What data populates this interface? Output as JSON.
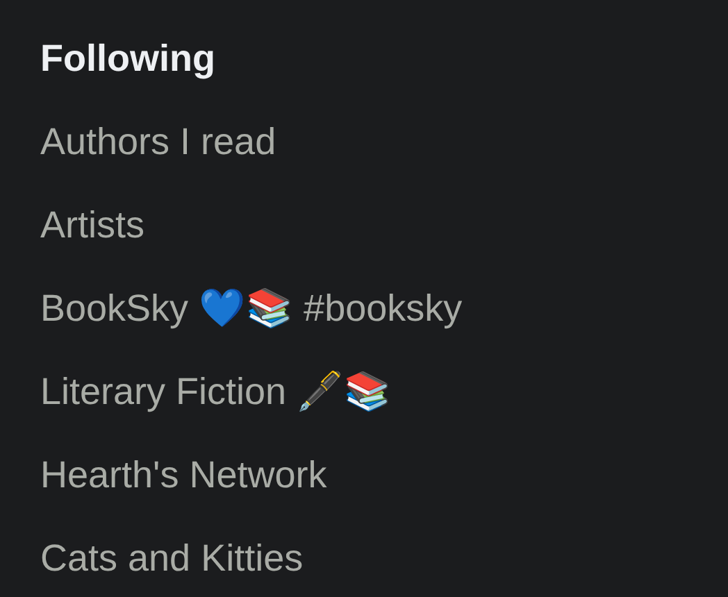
{
  "feeds": [
    {
      "label": "Following",
      "selected": true
    },
    {
      "label": "Authors I read",
      "selected": false
    },
    {
      "label": "Artists",
      "selected": false
    },
    {
      "label": "BookSky 💙📚 #booksky",
      "selected": false
    },
    {
      "label": "Literary Fiction 🖋️📚",
      "selected": false
    },
    {
      "label": "Hearth's Network",
      "selected": false
    },
    {
      "label": "Cats and Kitties",
      "selected": false
    }
  ]
}
